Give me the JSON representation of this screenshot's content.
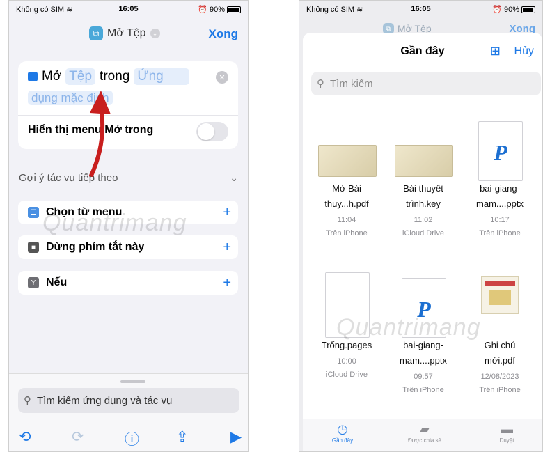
{
  "left": {
    "status": {
      "carrier": "Không có SIM",
      "time": "16:05",
      "battery": "90%"
    },
    "header": {
      "title": "Mở Tệp",
      "done_label": "Xong"
    },
    "action": {
      "verb": "Mở",
      "token_file": "Tệp",
      "word_in": "trong",
      "token_app_part1": "Ứng",
      "token_app_part2": "dụng mặc định",
      "toggle_label": "Hiển thị menu Mở trong",
      "toggle_on": false
    },
    "suggestions": {
      "heading": "Gợi ý tác vụ tiếp theo",
      "items": [
        {
          "label": "Chọn từ menu",
          "icon": "menu-icon",
          "color": "#4a90e2"
        },
        {
          "label": "Dừng phím tắt này",
          "icon": "stop-icon",
          "color": "#555555"
        },
        {
          "label": "Nếu",
          "icon": "if-icon",
          "color": "#6e6e73"
        }
      ]
    },
    "search": {
      "placeholder": "Tìm kiếm ứng dụng và tác vụ"
    }
  },
  "right": {
    "status": {
      "carrier": "Không có SIM",
      "time": "16:05",
      "battery": "90%"
    },
    "background": {
      "title": "Mở Tệp",
      "done_label": "Xong"
    },
    "sheet": {
      "title": "Gần đây",
      "cancel_label": "Hủy"
    },
    "search": {
      "placeholder": "Tìm kiếm"
    },
    "files": [
      {
        "name1": "Mở Bài",
        "name2": "thuy...h.pdf",
        "time": "11:04",
        "location": "Trên iPhone",
        "thumb": "photo"
      },
      {
        "name1": "Bài thuyết",
        "name2": "trình.key",
        "time": "11:02",
        "location": "iCloud Drive",
        "thumb": "photo"
      },
      {
        "name1": "bai-giang-",
        "name2": "mam....pptx",
        "time": "10:17",
        "location": "Trên iPhone",
        "thumb": "pptx"
      },
      {
        "name1": "",
        "name2": "Trống.pages",
        "time": "10:00",
        "location": "iCloud Drive",
        "thumb": "blank"
      },
      {
        "name1": "bai-giang-",
        "name2": "mam....pptx",
        "time": "09:57",
        "location": "Trên iPhone",
        "thumb": "pptx"
      },
      {
        "name1": "Ghi chú",
        "name2": "mới.pdf",
        "time": "12/08/2023",
        "location": "Trên iPhone",
        "thumb": "note"
      }
    ],
    "tabs": [
      {
        "label": "Gần đây",
        "icon": "clock-icon",
        "active": true
      },
      {
        "label": "Được chia sẻ",
        "icon": "shared-folder-icon",
        "active": false
      },
      {
        "label": "Duyệt",
        "icon": "folder-icon",
        "active": false
      }
    ]
  },
  "accent_color": "#1e79e6",
  "watermark": "Quantrimang"
}
